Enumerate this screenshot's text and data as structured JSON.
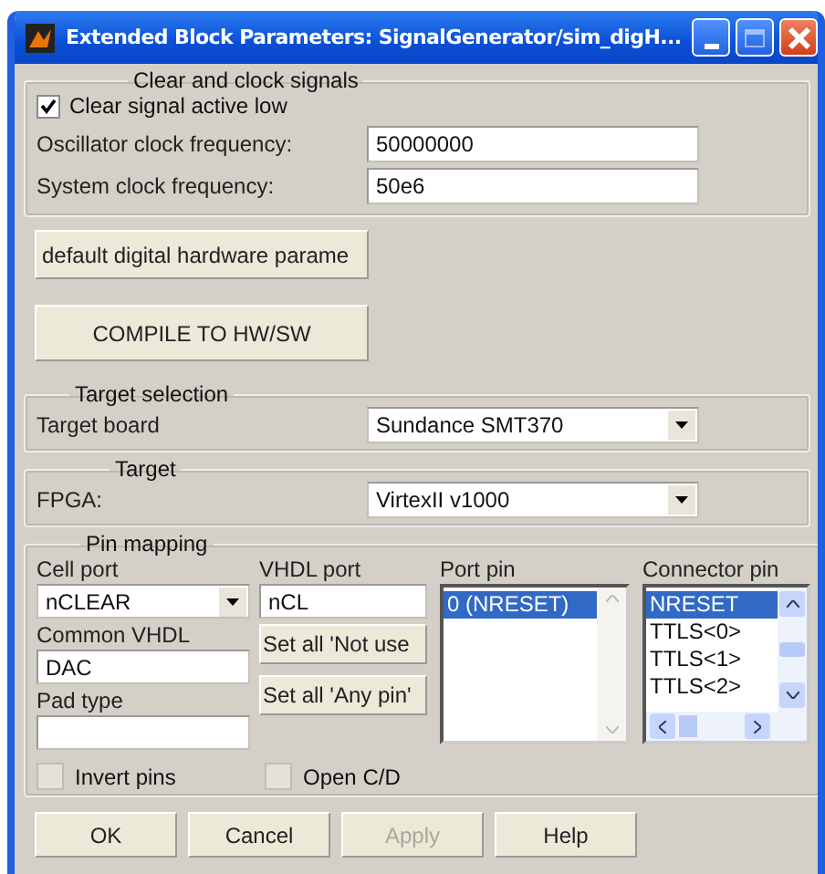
{
  "window": {
    "title": "Extended Block Parameters: SignalGenerator/sim_digH..."
  },
  "clock_signals": {
    "legend": "Clear and clock signals",
    "checkbox": {
      "label": "Clear signal active low",
      "checked": true
    },
    "fields": [
      {
        "label": "Oscillator clock frequency:",
        "value": "50000000"
      },
      {
        "label": "System clock frequency:",
        "value": "50e6"
      }
    ]
  },
  "action_buttons": [
    "default digital hardware parame",
    "COMPILE TO HW/SW"
  ],
  "target_selection": {
    "legend": "Target selection",
    "label": "Target board",
    "value": "Sundance SMT370"
  },
  "target": {
    "legend": "Target",
    "label": "FPGA:",
    "value": "VirtexII v1000"
  },
  "pin_mapping": {
    "legend": "Pin mapping",
    "cell_port": {
      "label": "Cell port",
      "value": "nCLEAR"
    },
    "common_vhdl": {
      "label": "Common VHDL",
      "value": "DAC"
    },
    "pad_type": {
      "label": "Pad type"
    },
    "vhdl_port": {
      "label": "VHDL port",
      "value": "nCL"
    },
    "set_buttons": [
      "Set all 'Not use",
      "Set all 'Any pin'"
    ],
    "port_pin": {
      "label": "Port pin",
      "items": [
        {
          "text": "0  (NRESET)",
          "selected": true
        }
      ]
    },
    "connector_pin": {
      "label": "Connector pin",
      "items": [
        {
          "text": "NRESET",
          "selected": true
        },
        {
          "text": "TTLS<0>",
          "selected": false
        },
        {
          "text": "TTLS<1>",
          "selected": false
        },
        {
          "text": "TTLS<2>",
          "selected": false
        }
      ]
    },
    "checkboxes": [
      {
        "label": "Invert pins",
        "checked": false
      },
      {
        "label": "Open C/D",
        "checked": false
      }
    ]
  },
  "footer_buttons": [
    {
      "label": "OK",
      "disabled": false
    },
    {
      "label": "Cancel",
      "disabled": false
    },
    {
      "label": "Apply",
      "disabled": true
    },
    {
      "label": "Help",
      "disabled": false
    }
  ]
}
